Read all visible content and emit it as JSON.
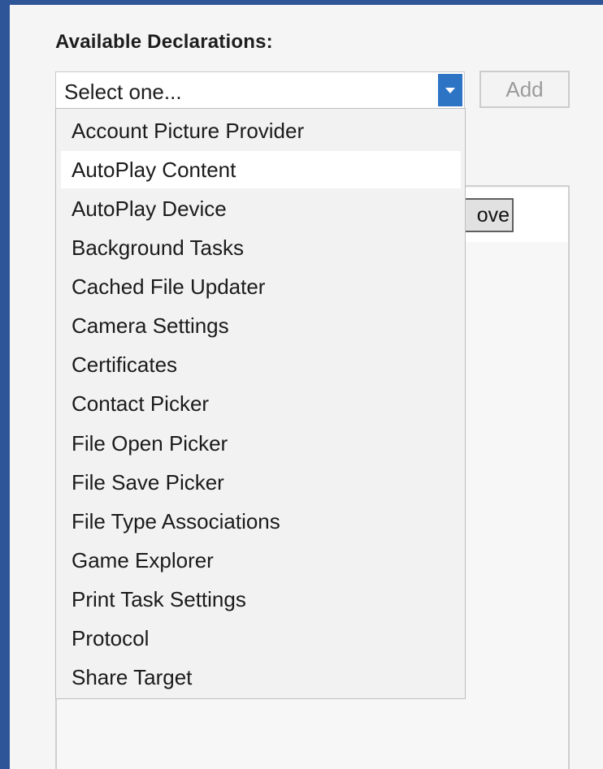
{
  "section": {
    "label": "Available Declarations:"
  },
  "combo": {
    "value": "Select one...",
    "icon": "chevron-down-icon"
  },
  "buttons": {
    "add": "Add",
    "remove_partial": "ove"
  },
  "dropdown": {
    "hovered_index": 1,
    "items": [
      "Account Picture Provider",
      "AutoPlay Content",
      "AutoPlay Device",
      "Background Tasks",
      "Cached File Updater",
      "Camera Settings",
      "Certificates",
      "Contact Picker",
      "File Open Picker",
      "File Save Picker",
      "File Type Associations",
      "Game Explorer",
      "Print Task Settings",
      "Protocol",
      "Share Target"
    ]
  },
  "colors": {
    "accent": "#2e74c5",
    "frame": "#2e5597"
  }
}
